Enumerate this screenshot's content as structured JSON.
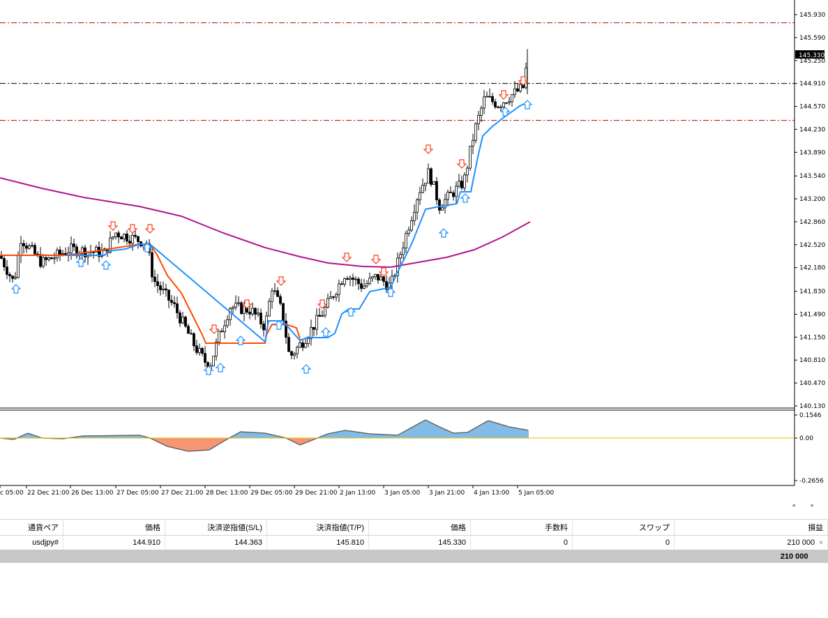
{
  "colors": {
    "candle": "#000000",
    "ma_line": "#b0158c",
    "trail_down": "#ff4a00",
    "trail_up": "#1e90ff",
    "arrow_down": "#ff3b1a",
    "arrow_up": "#1e90ff",
    "hist_pos": "#2e8fd6",
    "hist_neg": "#f0501a",
    "zero_line": "#e6c300",
    "sl_tp_line": "#c00000",
    "entry_line": "#000000",
    "price_label_bg": "#000000"
  },
  "price_axis": {
    "ticks": [
      "145.930",
      "145.590",
      "145.250",
      "144.910",
      "144.570",
      "144.230",
      "143.890",
      "143.540",
      "143.200",
      "142.860",
      "142.520",
      "142.180",
      "141.830",
      "141.490",
      "141.150",
      "140.810",
      "140.470",
      "140.130"
    ],
    "current_price": "145.330"
  },
  "oscillator_axis": {
    "ticks": [
      "0.1546",
      "0.00",
      "-0.2656"
    ]
  },
  "time_axis": {
    "labels": [
      "c 05:00",
      "22 Dec 21:00",
      "26 Dec 13:00",
      "27 Dec 05:00",
      "27 Dec 21:00",
      "28 Dec 13:00",
      "29 Dec 05:00",
      "29 Dec 21:00",
      "2 Jan 13:00",
      "3 Jan 05:00",
      "3 Jan 21:00",
      "4 Jan 13:00",
      "5 Jan 05:00"
    ]
  },
  "levels": {
    "take_profit": 145.81,
    "entry": 144.91,
    "stop_loss": 144.363
  },
  "panel": {
    "scroll_arrows": "◂ ▸",
    "columns": [
      "通貨ペア",
      "価格",
      "決済逆指値(S/L)",
      "決済指値(T/P)",
      "価格",
      "手数料",
      "スワップ",
      "損益"
    ],
    "rows": [
      {
        "symbol": "usdjpy#",
        "open_price": "144.910",
        "sl": "144.363",
        "tp": "145.810",
        "price": "145.330",
        "commission": "0",
        "swap": "0",
        "profit": "210 000"
      }
    ],
    "close_icon": "×",
    "total": "210 000"
  }
}
